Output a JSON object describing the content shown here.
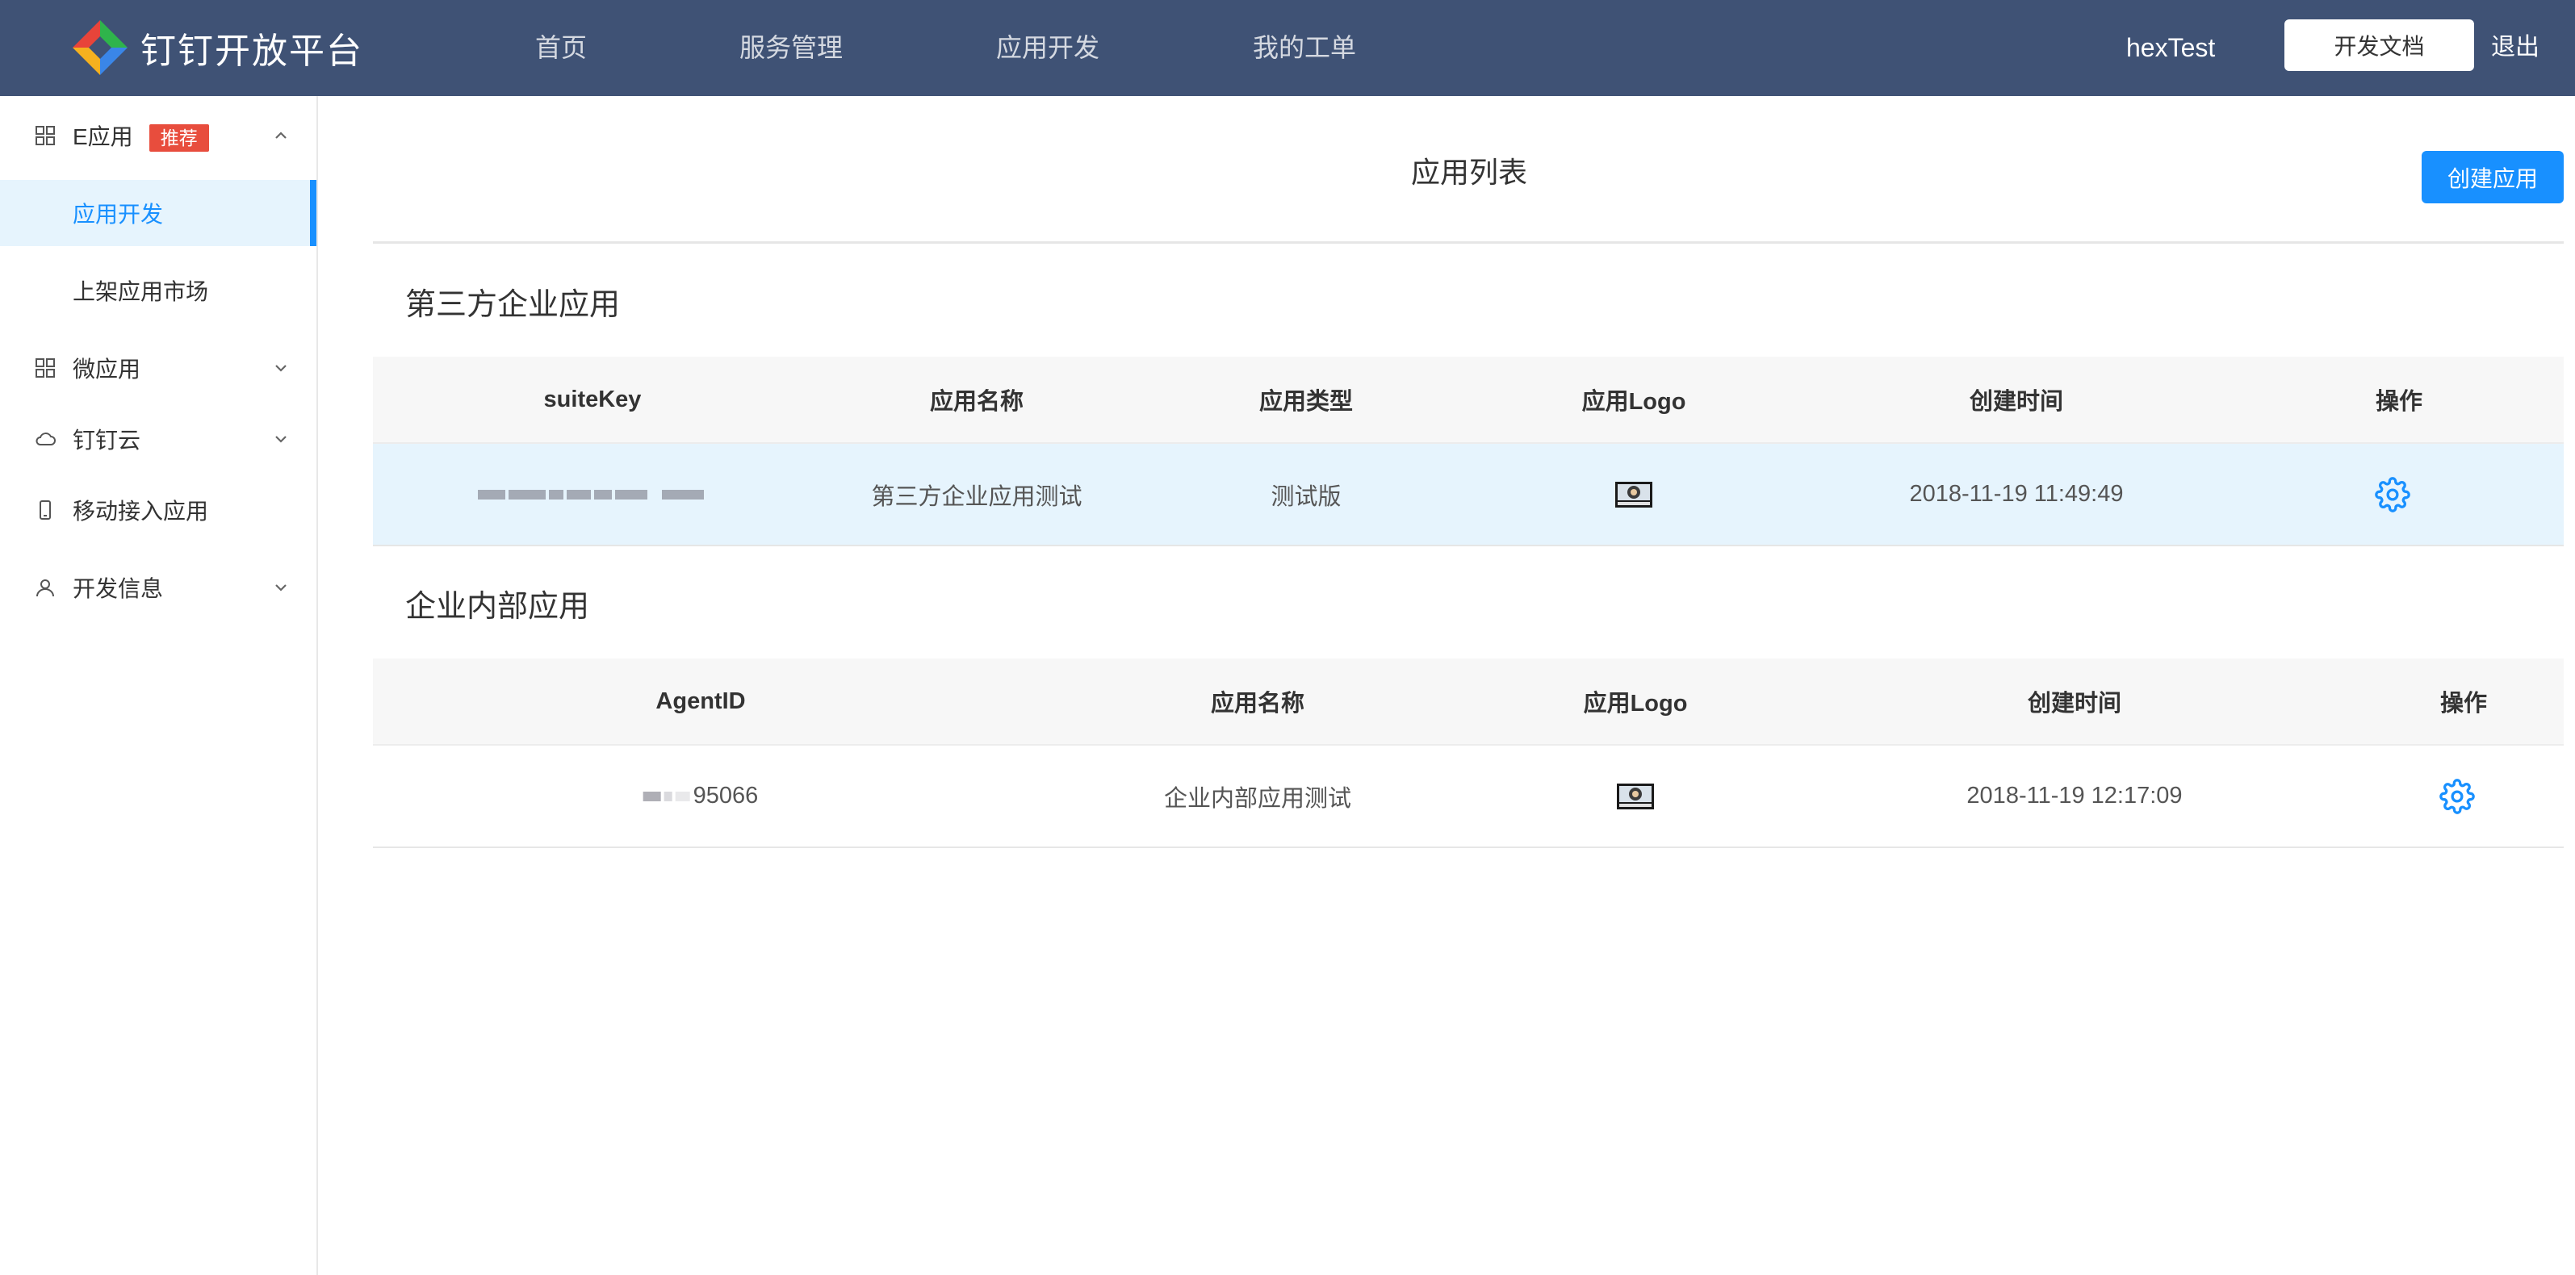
{
  "header": {
    "brand": "钉钉开放平台",
    "nav": [
      "首页",
      "服务管理",
      "应用开发",
      "我的工单"
    ],
    "user": "hexTest",
    "doc_button": "开发文档",
    "logout": "退出"
  },
  "sidebar": {
    "items": [
      {
        "label": "E应用",
        "badge": "推荐",
        "icon": "grid-icon",
        "expanded": true
      },
      {
        "label": "应用开发",
        "active": true
      },
      {
        "label": "上架应用市场"
      },
      {
        "label": "微应用",
        "icon": "grid-icon"
      },
      {
        "label": "钉钉云",
        "icon": "cloud-icon"
      },
      {
        "label": "移动接入应用",
        "icon": "mobile-icon"
      },
      {
        "label": "开发信息",
        "icon": "user-icon"
      }
    ]
  },
  "main": {
    "title": "应用列表",
    "create_button": "创建应用",
    "third_party": {
      "section_title": "第三方企业应用",
      "headers": [
        "suiteKey",
        "应用名称",
        "应用类型",
        "应用Logo",
        "创建时间",
        "操作"
      ],
      "rows": [
        {
          "name": "第三方企业应用测试",
          "type": "测试版",
          "created": "2018-11-19 11:49:49"
        }
      ]
    },
    "internal": {
      "section_title": "企业内部应用",
      "headers": [
        "AgentID",
        "应用名称",
        "应用Logo",
        "创建时间",
        "操作"
      ],
      "rows": [
        {
          "agent_id_visible": "95066",
          "name": "企业内部应用测试",
          "created": "2018-11-19 12:17:09"
        }
      ]
    }
  },
  "colors": {
    "topbar": "#3f5275",
    "accent": "#1890ff",
    "badge": "#e84d3d",
    "row_highlight": "#e6f4fd"
  }
}
